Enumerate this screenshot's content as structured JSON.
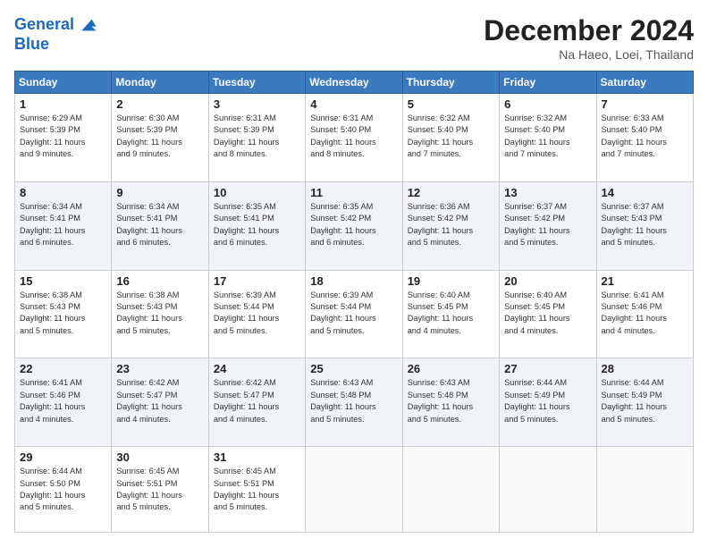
{
  "header": {
    "logo_line1": "General",
    "logo_line2": "Blue",
    "month_title": "December 2024",
    "location": "Na Haeo, Loei, Thailand"
  },
  "days_of_week": [
    "Sunday",
    "Monday",
    "Tuesday",
    "Wednesday",
    "Thursday",
    "Friday",
    "Saturday"
  ],
  "weeks": [
    [
      {
        "day": "1",
        "lines": [
          "Sunrise: 6:29 AM",
          "Sunset: 5:39 PM",
          "Daylight: 11 hours",
          "and 9 minutes."
        ]
      },
      {
        "day": "2",
        "lines": [
          "Sunrise: 6:30 AM",
          "Sunset: 5:39 PM",
          "Daylight: 11 hours",
          "and 9 minutes."
        ]
      },
      {
        "day": "3",
        "lines": [
          "Sunrise: 6:31 AM",
          "Sunset: 5:39 PM",
          "Daylight: 11 hours",
          "and 8 minutes."
        ]
      },
      {
        "day": "4",
        "lines": [
          "Sunrise: 6:31 AM",
          "Sunset: 5:40 PM",
          "Daylight: 11 hours",
          "and 8 minutes."
        ]
      },
      {
        "day": "5",
        "lines": [
          "Sunrise: 6:32 AM",
          "Sunset: 5:40 PM",
          "Daylight: 11 hours",
          "and 7 minutes."
        ]
      },
      {
        "day": "6",
        "lines": [
          "Sunrise: 6:32 AM",
          "Sunset: 5:40 PM",
          "Daylight: 11 hours",
          "and 7 minutes."
        ]
      },
      {
        "day": "7",
        "lines": [
          "Sunrise: 6:33 AM",
          "Sunset: 5:40 PM",
          "Daylight: 11 hours",
          "and 7 minutes."
        ]
      }
    ],
    [
      {
        "day": "8",
        "lines": [
          "Sunrise: 6:34 AM",
          "Sunset: 5:41 PM",
          "Daylight: 11 hours",
          "and 6 minutes."
        ]
      },
      {
        "day": "9",
        "lines": [
          "Sunrise: 6:34 AM",
          "Sunset: 5:41 PM",
          "Daylight: 11 hours",
          "and 6 minutes."
        ]
      },
      {
        "day": "10",
        "lines": [
          "Sunrise: 6:35 AM",
          "Sunset: 5:41 PM",
          "Daylight: 11 hours",
          "and 6 minutes."
        ]
      },
      {
        "day": "11",
        "lines": [
          "Sunrise: 6:35 AM",
          "Sunset: 5:42 PM",
          "Daylight: 11 hours",
          "and 6 minutes."
        ]
      },
      {
        "day": "12",
        "lines": [
          "Sunrise: 6:36 AM",
          "Sunset: 5:42 PM",
          "Daylight: 11 hours",
          "and 5 minutes."
        ]
      },
      {
        "day": "13",
        "lines": [
          "Sunrise: 6:37 AM",
          "Sunset: 5:42 PM",
          "Daylight: 11 hours",
          "and 5 minutes."
        ]
      },
      {
        "day": "14",
        "lines": [
          "Sunrise: 6:37 AM",
          "Sunset: 5:43 PM",
          "Daylight: 11 hours",
          "and 5 minutes."
        ]
      }
    ],
    [
      {
        "day": "15",
        "lines": [
          "Sunrise: 6:38 AM",
          "Sunset: 5:43 PM",
          "Daylight: 11 hours",
          "and 5 minutes."
        ]
      },
      {
        "day": "16",
        "lines": [
          "Sunrise: 6:38 AM",
          "Sunset: 5:43 PM",
          "Daylight: 11 hours",
          "and 5 minutes."
        ]
      },
      {
        "day": "17",
        "lines": [
          "Sunrise: 6:39 AM",
          "Sunset: 5:44 PM",
          "Daylight: 11 hours",
          "and 5 minutes."
        ]
      },
      {
        "day": "18",
        "lines": [
          "Sunrise: 6:39 AM",
          "Sunset: 5:44 PM",
          "Daylight: 11 hours",
          "and 5 minutes."
        ]
      },
      {
        "day": "19",
        "lines": [
          "Sunrise: 6:40 AM",
          "Sunset: 5:45 PM",
          "Daylight: 11 hours",
          "and 4 minutes."
        ]
      },
      {
        "day": "20",
        "lines": [
          "Sunrise: 6:40 AM",
          "Sunset: 5:45 PM",
          "Daylight: 11 hours",
          "and 4 minutes."
        ]
      },
      {
        "day": "21",
        "lines": [
          "Sunrise: 6:41 AM",
          "Sunset: 5:46 PM",
          "Daylight: 11 hours",
          "and 4 minutes."
        ]
      }
    ],
    [
      {
        "day": "22",
        "lines": [
          "Sunrise: 6:41 AM",
          "Sunset: 5:46 PM",
          "Daylight: 11 hours",
          "and 4 minutes."
        ]
      },
      {
        "day": "23",
        "lines": [
          "Sunrise: 6:42 AM",
          "Sunset: 5:47 PM",
          "Daylight: 11 hours",
          "and 4 minutes."
        ]
      },
      {
        "day": "24",
        "lines": [
          "Sunrise: 6:42 AM",
          "Sunset: 5:47 PM",
          "Daylight: 11 hours",
          "and 4 minutes."
        ]
      },
      {
        "day": "25",
        "lines": [
          "Sunrise: 6:43 AM",
          "Sunset: 5:48 PM",
          "Daylight: 11 hours",
          "and 5 minutes."
        ]
      },
      {
        "day": "26",
        "lines": [
          "Sunrise: 6:43 AM",
          "Sunset: 5:48 PM",
          "Daylight: 11 hours",
          "and 5 minutes."
        ]
      },
      {
        "day": "27",
        "lines": [
          "Sunrise: 6:44 AM",
          "Sunset: 5:49 PM",
          "Daylight: 11 hours",
          "and 5 minutes."
        ]
      },
      {
        "day": "28",
        "lines": [
          "Sunrise: 6:44 AM",
          "Sunset: 5:49 PM",
          "Daylight: 11 hours",
          "and 5 minutes."
        ]
      }
    ],
    [
      {
        "day": "29",
        "lines": [
          "Sunrise: 6:44 AM",
          "Sunset: 5:50 PM",
          "Daylight: 11 hours",
          "and 5 minutes."
        ]
      },
      {
        "day": "30",
        "lines": [
          "Sunrise: 6:45 AM",
          "Sunset: 5:51 PM",
          "Daylight: 11 hours",
          "and 5 minutes."
        ]
      },
      {
        "day": "31",
        "lines": [
          "Sunrise: 6:45 AM",
          "Sunset: 5:51 PM",
          "Daylight: 11 hours",
          "and 5 minutes."
        ]
      },
      {
        "day": "",
        "lines": []
      },
      {
        "day": "",
        "lines": []
      },
      {
        "day": "",
        "lines": []
      },
      {
        "day": "",
        "lines": []
      }
    ]
  ]
}
